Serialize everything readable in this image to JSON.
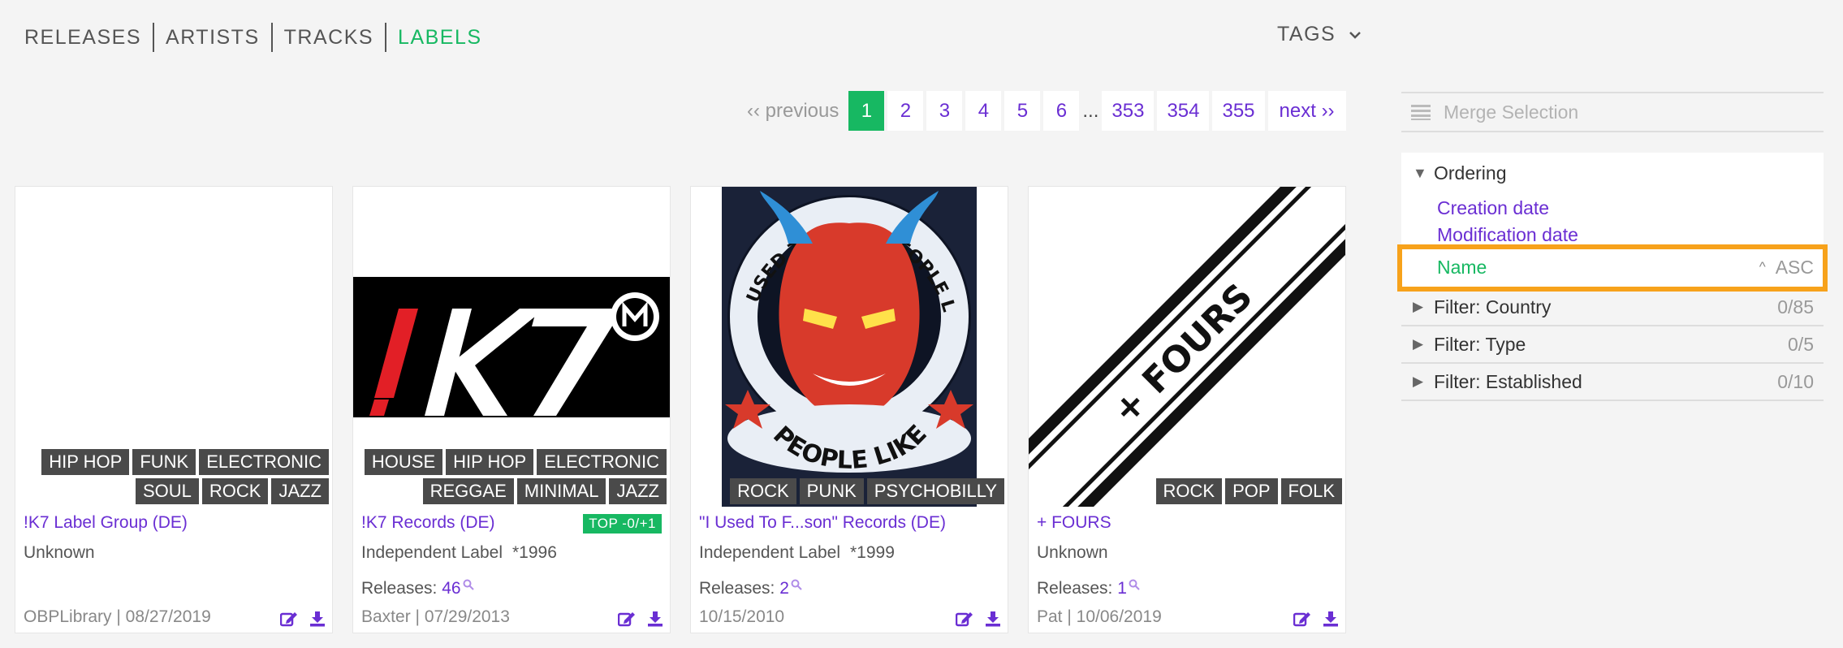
{
  "nav": {
    "items": [
      {
        "label": "RELEASES"
      },
      {
        "label": "ARTISTS"
      },
      {
        "label": "TRACKS"
      },
      {
        "label": "LABELS"
      }
    ],
    "active": "LABELS",
    "tags_label": "TAGS"
  },
  "pagination": {
    "previous": "‹‹ previous",
    "pages": [
      "1",
      "2",
      "3",
      "4",
      "5",
      "6"
    ],
    "ellipsis": "...",
    "last_pages": [
      "353",
      "354",
      "355"
    ],
    "next": "next ››",
    "current": "1"
  },
  "sidebar": {
    "merge_label": "Merge Selection",
    "ordering": {
      "title": "Ordering",
      "options": [
        "Creation date",
        "Modification date"
      ],
      "selected": {
        "label": "Name",
        "direction": "ASC"
      }
    },
    "filters": [
      {
        "label": "Filter: Country",
        "count": "0/85"
      },
      {
        "label": "Filter: Type",
        "count": "0/5"
      },
      {
        "label": "Filter: Established",
        "count": "0/10"
      }
    ]
  },
  "cards": [
    {
      "title": "!K7 Label Group (DE)",
      "type": "Unknown",
      "established": "",
      "badge": "",
      "releases_label": "",
      "releases_count": "",
      "footer": "OBPLibrary | 08/27/2019",
      "tag_rows": [
        [
          "HIP HOP",
          "FUNK",
          "ELECTRONIC"
        ],
        [
          "SOUL",
          "ROCK",
          "JAZZ"
        ]
      ],
      "image": "blank"
    },
    {
      "title": "!K7 Records (DE)",
      "type": "Independent Label",
      "established": "*1996",
      "badge": "TOP -0/+1",
      "releases_label": "Releases: ",
      "releases_count": "46",
      "footer": "Baxter | 07/29/2013",
      "tag_rows": [
        [
          "HOUSE",
          "HIP HOP",
          "ELECTRONIC"
        ],
        [
          "REGGAE",
          "MINIMAL",
          "JAZZ"
        ]
      ],
      "image": "k7-logo"
    },
    {
      "title": "\"I Used To F...son\" Records (DE)",
      "type": "Independent Label",
      "established": "*1999",
      "badge": "",
      "releases_label": "Releases: ",
      "releases_count": "2",
      "footer": "10/15/2010",
      "tag_rows": [
        [
          "ROCK",
          "PUNK",
          "PSYCHOBILLY"
        ]
      ],
      "image": "devil-logo",
      "image_text_top": "USED TO FUCK PEOPLE LIKE YOU IN PRISON",
      "image_text_bottom": "PEOPLE LIKE YOU"
    },
    {
      "title": "+ FOURS",
      "type": "Unknown",
      "established": "",
      "badge": "",
      "releases_label": "Releases: ",
      "releases_count": "1",
      "footer": "Pat | 10/06/2019",
      "tag_rows": [
        [
          "ROCK",
          "POP",
          "FOLK"
        ]
      ],
      "image": "fours-logo",
      "image_text": "+ FOURS"
    }
  ],
  "colors": {
    "accent": "#17b862",
    "link": "#6a2ed3",
    "highlight": "#f7a21b",
    "tag_bg": "#4a4a4a"
  }
}
